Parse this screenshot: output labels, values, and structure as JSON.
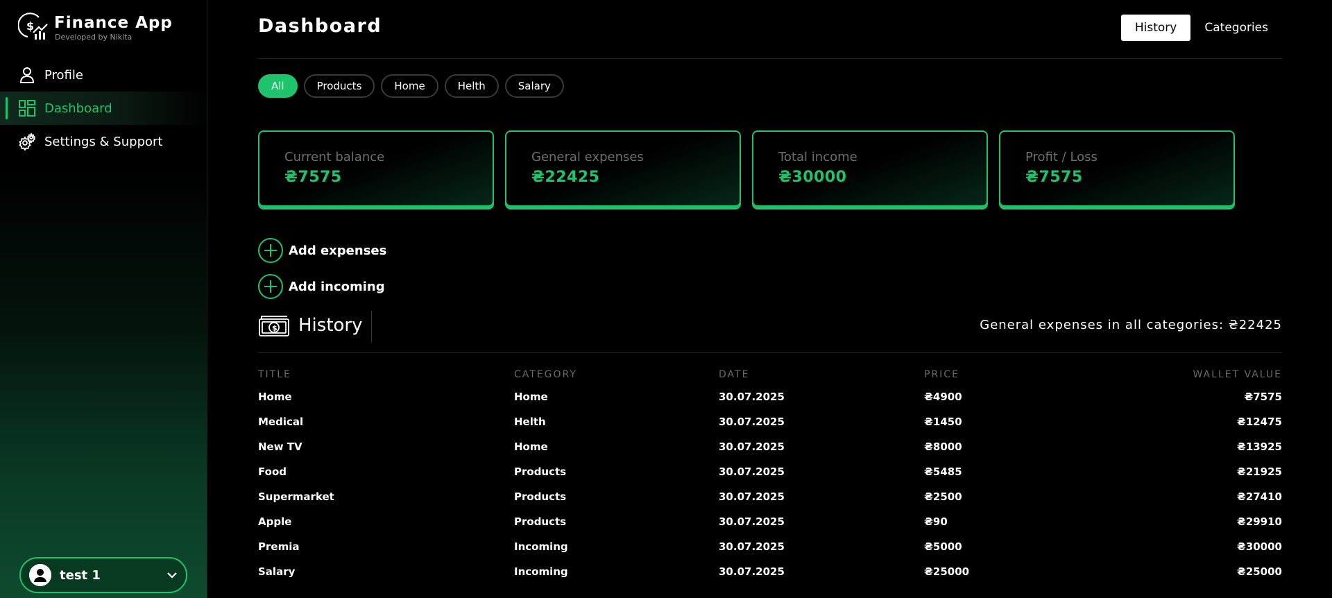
{
  "brand": {
    "title": "Finance App",
    "subtitle": "Developed by Nikita"
  },
  "nav": [
    {
      "label": "Profile",
      "icon": "user-icon"
    },
    {
      "label": "Dashboard",
      "icon": "grid-icon",
      "active": true
    },
    {
      "label": "Settings & Support",
      "icon": "gear-icon"
    }
  ],
  "user": {
    "name": "test 1"
  },
  "header": {
    "title": "Dashboard",
    "tabs": [
      "History",
      "Categories"
    ],
    "active_tab": "History"
  },
  "filters": [
    "All",
    "Products",
    "Home",
    "Helth",
    "Salary"
  ],
  "cards": [
    {
      "label": "Current balance",
      "value": "₴7575"
    },
    {
      "label": "General expenses",
      "value": "₴22425"
    },
    {
      "label": "Total income",
      "value": "₴30000"
    },
    {
      "label": "Profit / Loss",
      "value": "₴7575"
    }
  ],
  "actions": {
    "add_expenses": "Add expenses",
    "add_incoming": "Add incoming"
  },
  "history": {
    "title": "History",
    "total_text": "General expenses in all categories: ₴22425",
    "columns": [
      "TITLE",
      "CATEGORY",
      "DATE",
      "PRICE",
      "WALLET VALUE"
    ],
    "rows": [
      [
        "Home",
        "Home",
        "30.07.2025",
        "₴4900",
        "₴7575"
      ],
      [
        "Medical",
        "Helth",
        "30.07.2025",
        "₴1450",
        "₴12475"
      ],
      [
        "New TV",
        "Home",
        "30.07.2025",
        "₴8000",
        "₴13925"
      ],
      [
        "Food",
        "Products",
        "30.07.2025",
        "₴5485",
        "₴21925"
      ],
      [
        "Supermarket",
        "Products",
        "30.07.2025",
        "₴2500",
        "₴27410"
      ],
      [
        "Apple",
        "Products",
        "30.07.2025",
        "₴90",
        "₴29910"
      ],
      [
        "Premia",
        "Incoming",
        "30.07.2025",
        "₴5000",
        "₴30000"
      ],
      [
        "Salary",
        "Incoming",
        "30.07.2025",
        "₴25000",
        "₴25000"
      ]
    ]
  },
  "colors": {
    "accent": "#1fc36b",
    "background": "#000000"
  }
}
